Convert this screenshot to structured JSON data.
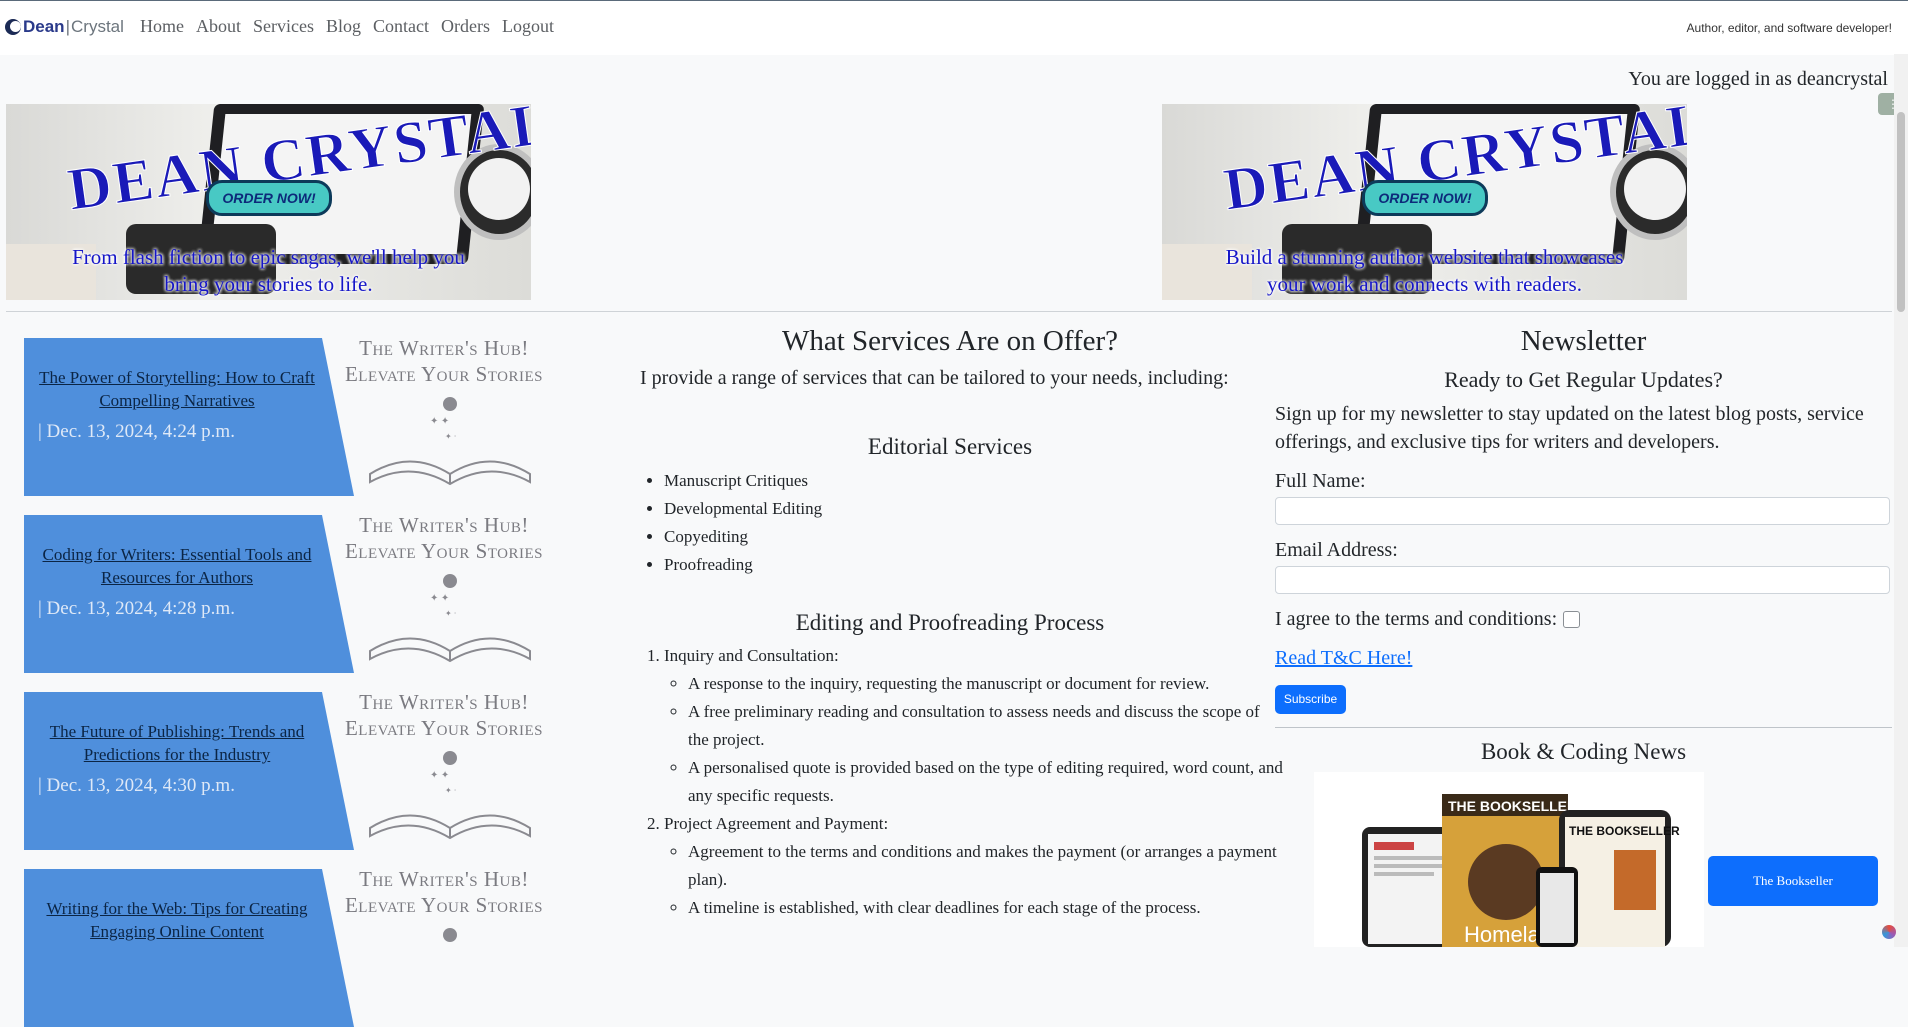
{
  "header": {
    "logo": {
      "dean": "Dean",
      "sep": "|",
      "crystal": "Crystal"
    },
    "nav": [
      "Home",
      "About",
      "Services",
      "Blog",
      "Contact",
      "Orders",
      "Logout"
    ],
    "tagline": "Author, editor, and software developer!",
    "login_message": "You are logged in as deancrystal"
  },
  "banners": [
    {
      "title": "DEAN CRYSTAL",
      "button": "ORDER NOW!",
      "caption_1": "From flash fiction to epic sagas, we'll help you",
      "caption_2": "bring your stories to life."
    },
    {
      "title": "DEAN CRYSTAL",
      "button": "ORDER NOW!",
      "caption_1": "Build a stunning author website that showcases",
      "caption_2": "your work and connects with readers."
    }
  ],
  "blog_cards": [
    {
      "title": "The Power of Storytelling: How to Craft Compelling Narratives",
      "date": "| Dec. 13, 2024, 4:24 p.m.",
      "hub_1": "The Writer's Hub!",
      "hub_2": "Elevate Your Stories"
    },
    {
      "title": "Coding for Writers: Essential Tools and Resources for Authors",
      "date": "| Dec. 13, 2024, 4:28 p.m.",
      "hub_1": "The Writer's Hub!",
      "hub_2": "Elevate Your Stories"
    },
    {
      "title": "The Future of Publishing: Trends and Predictions for the Industry",
      "date": "| Dec. 13, 2024, 4:30 p.m.",
      "hub_1": "The Writer's Hub!",
      "hub_2": "Elevate Your Stories"
    },
    {
      "title": "Writing for the Web: Tips for Creating Engaging Online Content",
      "date": "",
      "hub_1": "The Writer's Hub!",
      "hub_2": "Elevate Your Stories"
    }
  ],
  "services": {
    "title": "What Services Are on Offer?",
    "intro": "I provide a range of services that can be tailored to your needs, including:",
    "editorial_title": "Editorial Services",
    "editorial_items": [
      "Manuscript Critiques",
      "Developmental Editing",
      "Copyediting",
      "Proofreading"
    ],
    "process_title": "Editing and Proofreading Process",
    "step1": "Inquiry and Consultation:",
    "step1_items": [
      "A response to the inquiry, requesting the manuscript or document for review.",
      "A free preliminary reading and consultation to assess needs and discuss the scope of the project.",
      "A personalised quote is provided based on the type of editing required, word count, and any specific requests."
    ],
    "step2": "Project Agreement and Payment:",
    "step2_items": [
      "Agreement to the terms and conditions and makes the payment (or arranges a payment plan).",
      "A timeline is established, with clear deadlines for each stage of the process."
    ]
  },
  "newsletter": {
    "title": "Newsletter",
    "subtitle": "Ready to Get Regular Updates?",
    "description": "Sign up for my newsletter to stay updated on the latest blog posts, service offerings, and exclusive tips for writers and developers.",
    "name_label": "Full Name:",
    "email_label": "Email Address:",
    "agree_label": "I agree to the terms and conditions:",
    "tc_link": "Read T&C Here!",
    "subscribe": "Subscribe",
    "news_title": "Book & Coding News",
    "mag_1": "THE BOOKSELLER",
    "mag_2": "THE BOOKSELLER",
    "mag_cover_text": "Homelan",
    "bookseller_button": "The Bookseller"
  }
}
